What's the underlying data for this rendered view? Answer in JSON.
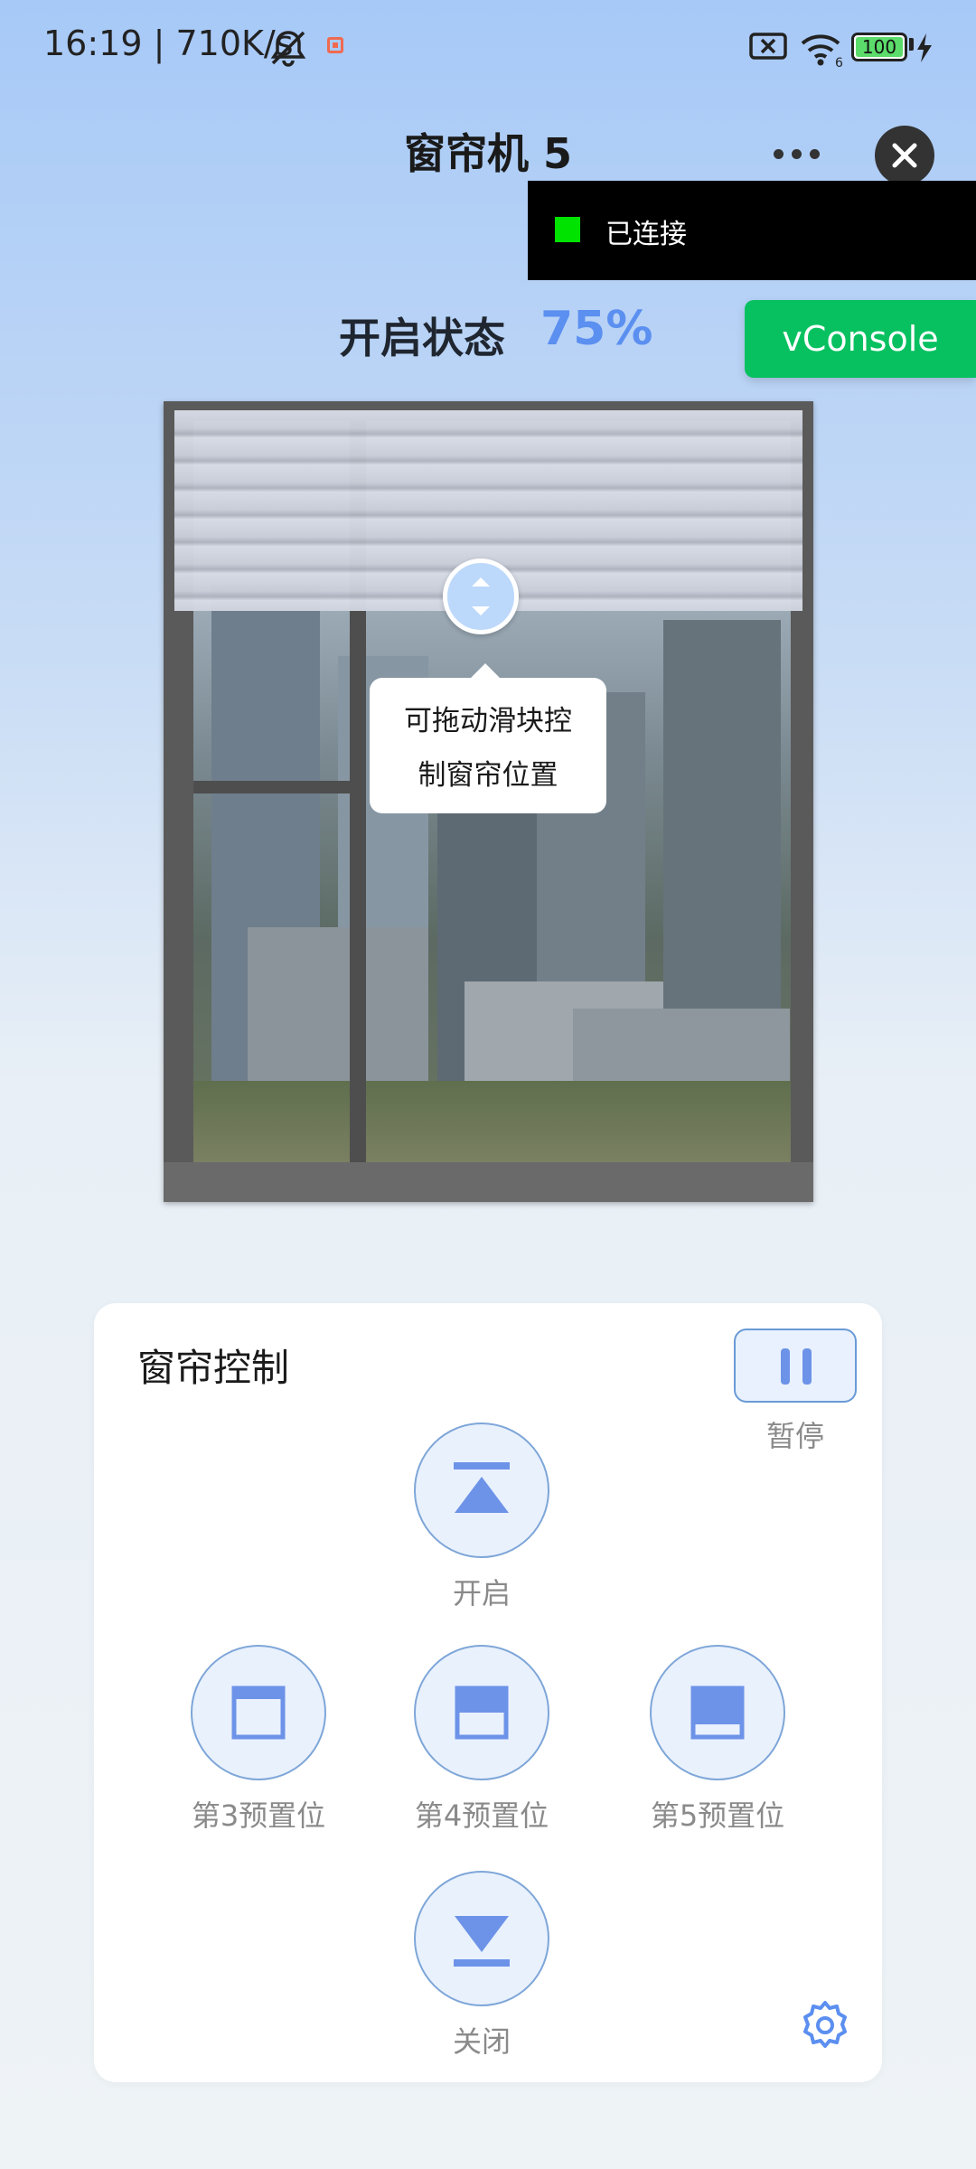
{
  "status_bar": {
    "time_speed": "16:19 | 710K/s",
    "battery": "100",
    "icons": [
      "mute-icon",
      "recording-icon",
      "sim-off-icon",
      "wifi-icon",
      "battery-icon",
      "charging-icon"
    ]
  },
  "header": {
    "title": "窗帘机 5"
  },
  "toast": {
    "text": "已连接"
  },
  "vconsole": {
    "label": "vConsole"
  },
  "curtain": {
    "status_label": "开启状态",
    "open_value": "75%",
    "open_fraction": 0.75,
    "tooltip": "可拖动滑块控\n制窗帘位置"
  },
  "control": {
    "title": "窗帘控制",
    "pause_label": "暂停",
    "open_label": "开启",
    "preset3_label": "第3预置位",
    "preset4_label": "第4预置位",
    "preset5_label": "第5预置位",
    "close_label": "关闭"
  },
  "colors": {
    "accent": "#5b8ff0",
    "toast_dot": "#00e300",
    "vconsole_bg": "#07c160"
  }
}
